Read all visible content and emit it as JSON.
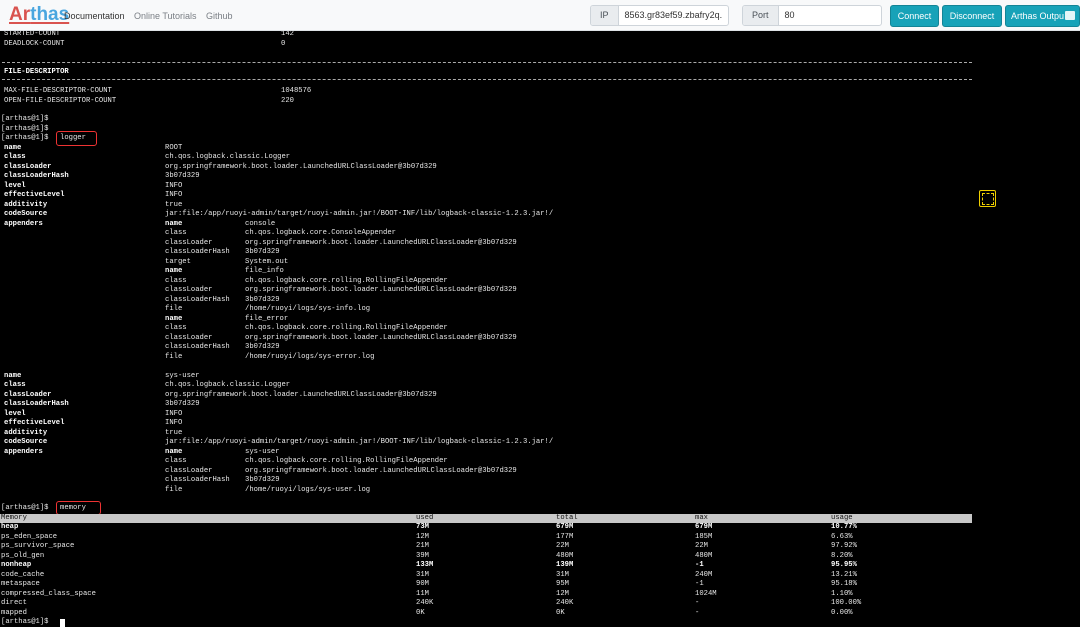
{
  "navbar": {
    "brand": "Arthas",
    "brand_prefix": "Ar",
    "brand_suffix": "thas",
    "links": [
      "Documentation",
      "Online Tutorials",
      "Github"
    ],
    "ip_label": "IP",
    "ip_value": "8563.gr83ef59.zbafry2q.",
    "port_label": "Port",
    "port_value": "80",
    "connect_label": "Connect",
    "disconnect_label": "Disconnect",
    "output_label": "Arthas Output",
    "accent_color": "#17a2b8",
    "brand_color": "#4aa6df",
    "brand_accent_color": "#d9534f"
  },
  "terminal": {
    "thread_stats": [
      {
        "label": "STARTED-COUNT",
        "value": "142"
      },
      {
        "label": "DEADLOCK-COUNT",
        "value": "0"
      }
    ],
    "fd_title": "FILE-DESCRIPTOR",
    "fd_stats": [
      {
        "label": "MAX-FILE-DESCRIPTOR-COUNT",
        "value": "1048576"
      },
      {
        "label": "OPEN-FILE-DESCRIPTOR-COUNT",
        "value": "220"
      }
    ],
    "prompt": "[arthas@1]$",
    "command_logger": "logger",
    "command_memory": "memory",
    "logger_blocks": [
      {
        "fields": [
          {
            "key": "name",
            "value": "ROOT"
          },
          {
            "key": "class",
            "value": "ch.qos.logback.classic.Logger"
          },
          {
            "key": "classLoader",
            "value": "org.springframework.boot.loader.LaunchedURLClassLoader@3b07d329"
          },
          {
            "key": "classLoaderHash",
            "value": "3b07d329"
          },
          {
            "key": "level",
            "value": "INFO"
          },
          {
            "key": "effectiveLevel",
            "value": "INFO"
          },
          {
            "key": "additivity",
            "value": "true"
          },
          {
            "key": "codeSource",
            "value": "jar:file:/app/ruoyi-admin/target/ruoyi-admin.jar!/BOOT-INF/lib/logback-classic-1.2.3.jar!/"
          },
          {
            "key": "appenders",
            "value": ""
          }
        ],
        "appenders": [
          {
            "key": "name",
            "value": "console"
          },
          {
            "key": "class",
            "value": "ch.qos.logback.core.ConsoleAppender"
          },
          {
            "key": "classLoader",
            "value": "org.springframework.boot.loader.LaunchedURLClassLoader@3b07d329"
          },
          {
            "key": "classLoaderHash",
            "value": "3b07d329"
          },
          {
            "key": "target",
            "value": "System.out"
          },
          {
            "key": "name",
            "value": "file_info"
          },
          {
            "key": "class",
            "value": "ch.qos.logback.core.rolling.RollingFileAppender"
          },
          {
            "key": "classLoader",
            "value": "org.springframework.boot.loader.LaunchedURLClassLoader@3b07d329"
          },
          {
            "key": "classLoaderHash",
            "value": "3b07d329"
          },
          {
            "key": "file",
            "value": "/home/ruoyi/logs/sys-info.log"
          },
          {
            "key": "name",
            "value": "file_error"
          },
          {
            "key": "class",
            "value": "ch.qos.logback.core.rolling.RollingFileAppender"
          },
          {
            "key": "classLoader",
            "value": "org.springframework.boot.loader.LaunchedURLClassLoader@3b07d329"
          },
          {
            "key": "classLoaderHash",
            "value": "3b07d329"
          },
          {
            "key": "file",
            "value": "/home/ruoyi/logs/sys-error.log"
          }
        ]
      },
      {
        "fields": [
          {
            "key": "name",
            "value": "sys-user"
          },
          {
            "key": "class",
            "value": "ch.qos.logback.classic.Logger"
          },
          {
            "key": "classLoader",
            "value": "org.springframework.boot.loader.LaunchedURLClassLoader@3b07d329"
          },
          {
            "key": "classLoaderHash",
            "value": "3b07d329"
          },
          {
            "key": "level",
            "value": "INFO"
          },
          {
            "key": "effectiveLevel",
            "value": "INFO"
          },
          {
            "key": "additivity",
            "value": "true"
          },
          {
            "key": "codeSource",
            "value": "jar:file:/app/ruoyi-admin/target/ruoyi-admin.jar!/BOOT-INF/lib/logback-classic-1.2.3.jar!/"
          },
          {
            "key": "appenders",
            "value": ""
          }
        ],
        "appenders": [
          {
            "key": "name",
            "value": "sys-user"
          },
          {
            "key": "class",
            "value": "ch.qos.logback.core.rolling.RollingFileAppender"
          },
          {
            "key": "classLoader",
            "value": "org.springframework.boot.loader.LaunchedURLClassLoader@3b07d329"
          },
          {
            "key": "classLoaderHash",
            "value": "3b07d329"
          },
          {
            "key": "file",
            "value": "/home/ruoyi/logs/sys-user.log"
          }
        ]
      }
    ],
    "memory_columns": [
      "Memory",
      "used",
      "total",
      "max",
      "usage"
    ],
    "memory_rows": [
      {
        "name": "heap",
        "used": "73M",
        "total": "679M",
        "max": "679M",
        "usage": "10.77%",
        "bold": true
      },
      {
        "name": "ps_eden_space",
        "used": "12M",
        "total": "177M",
        "max": "185M",
        "usage": "6.63%",
        "bold": false
      },
      {
        "name": "ps_survivor_space",
        "used": "21M",
        "total": "22M",
        "max": "22M",
        "usage": "97.92%",
        "bold": false
      },
      {
        "name": "ps_old_gen",
        "used": "39M",
        "total": "480M",
        "max": "480M",
        "usage": "8.20%",
        "bold": false
      },
      {
        "name": "nonheap",
        "used": "133M",
        "total": "139M",
        "max": "-1",
        "usage": "95.95%",
        "bold": true
      },
      {
        "name": "code_cache",
        "used": "31M",
        "total": "31M",
        "max": "240M",
        "usage": "13.21%",
        "bold": false
      },
      {
        "name": "metaspace",
        "used": "90M",
        "total": "95M",
        "max": "-1",
        "usage": "95.18%",
        "bold": false
      },
      {
        "name": "compressed_class_space",
        "used": "11M",
        "total": "12M",
        "max": "1024M",
        "usage": "1.10%",
        "bold": false
      },
      {
        "name": "direct",
        "used": "240K",
        "total": "240K",
        "max": "-",
        "usage": "100.00%",
        "bold": false
      },
      {
        "name": "mapped",
        "used": "0K",
        "total": "0K",
        "max": "-",
        "usage": "0.00%",
        "bold": false
      }
    ]
  }
}
